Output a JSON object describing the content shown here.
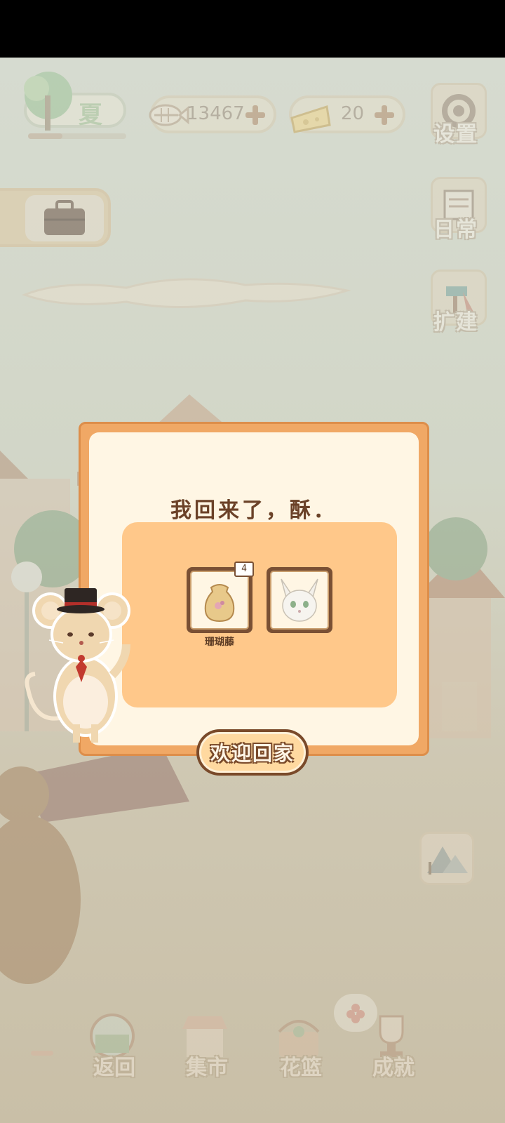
{
  "hud": {
    "season_label": "夏",
    "season_progress": 0.35,
    "fish_currency": "13467",
    "cheese_currency": "20"
  },
  "side_menu": {
    "settings_label": "设置",
    "daily_label": "日常",
    "expand_label": "扩建"
  },
  "dialog": {
    "title": "我回来了，酥．",
    "rewards": [
      {
        "name": "珊瑚藤",
        "count": "4",
        "icon": "seed-bag-icon"
      },
      {
        "name": "",
        "count": "",
        "icon": "white-fox-portrait"
      }
    ],
    "confirm_label": "欢迎回家"
  },
  "bottom_nav": {
    "items": [
      {
        "label": "返回",
        "icon": "window-icon"
      },
      {
        "label": "集市",
        "icon": "market-stall-icon"
      },
      {
        "label": "花篮",
        "icon": "flower-basket-icon"
      },
      {
        "label": "成就",
        "icon": "trophy-icon"
      }
    ]
  },
  "colors": {
    "dialog_frame": "#f0a865",
    "dialog_panel": "#ffc88a",
    "dialog_bg": "#fff6e4",
    "title_text": "#6b4228"
  }
}
